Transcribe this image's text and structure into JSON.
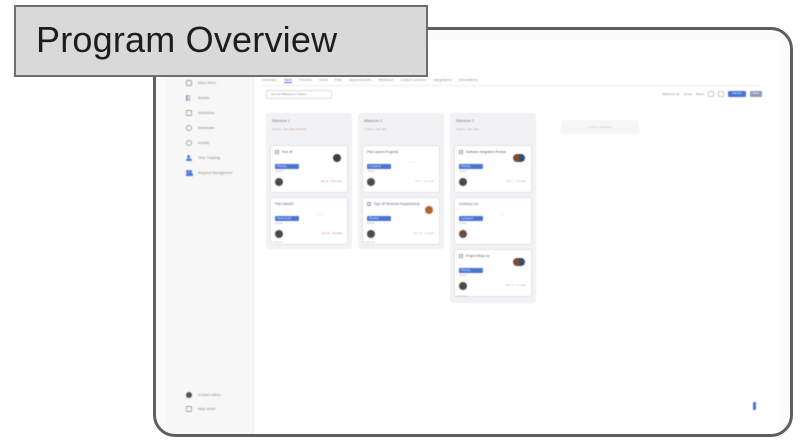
{
  "title": "Program Overview",
  "sidebar": {
    "items": [
      {
        "label": "Inbox Items"
      },
      {
        "label": "Boards"
      },
      {
        "label": "Schedules"
      },
      {
        "label": "Workloads"
      },
      {
        "label": "Activity"
      },
      {
        "label": "Time Tracking"
      },
      {
        "label": "Request Management"
      }
    ],
    "footer": [
      {
        "label": "Contact admin"
      },
      {
        "label": "Help center"
      }
    ]
  },
  "tabs": [
    "Overview",
    "Table",
    "Timeline",
    "Gantt",
    "Files",
    "Dependencies",
    "Workload",
    "Custom columns",
    "Integrations",
    "Automations"
  ],
  "active_tab": "Table",
  "toolbar": {
    "filter_label": "Sort by Milestone & Status",
    "right_text": "Milestone (3)",
    "group_label": "Group",
    "view_label": "Board",
    "primary_label": "Add item",
    "secondary_label": "Share"
  },
  "columns": [
    {
      "title": "Milestone 1",
      "subtitle": "2 items · Due date",
      "subtitle_flag": "Overdue",
      "cards": [
        {
          "title": "Kick off",
          "badge": "Planning",
          "owner": "Owner",
          "meta": "Oct 12 · Due soon",
          "meta_red": true,
          "photo": "dark"
        },
        {
          "title": "Plan Handoff",
          "badge": "Review & QA",
          "owner": "Owner",
          "meta": "Oct 24 · Overdue",
          "meta_red": true,
          "photo": "none"
        }
      ],
      "footer": "+ Add item"
    },
    {
      "title": "Milestone 2",
      "subtitle": "2 items · Due date",
      "subtitle_flag": "",
      "cards": [
        {
          "title": "Pilot Launch Progress",
          "badge": "In progress",
          "owner": "Owner",
          "meta": "Nov 3 · On track",
          "meta_red": false,
          "photo": "none"
        },
        {
          "title": "Sign-off Technical Requirements",
          "badge": "Planning",
          "owner": "Owner",
          "meta": "Nov 14 · On track",
          "meta_red": false,
          "photo": "warm"
        }
      ],
      "footer": "+ Add item"
    },
    {
      "title": "Milestone 3",
      "subtitle": "3 items · Due date",
      "subtitle_flag": "",
      "cards": [
        {
          "title": "Software Integration Review",
          "badge": "Planning",
          "owner": "Owner",
          "meta": "Dec 1 · On track",
          "meta_red": false,
          "photo": "duo"
        },
        {
          "title": "Inventory List",
          "badge": "In progress",
          "owner": "Owner",
          "meta": "Dec 8",
          "meta_red": false,
          "photo": "none"
        },
        {
          "title": "Project Wrap-Up",
          "badge": "Planning",
          "owner": "Owner",
          "meta": "Dec 19 · On track",
          "meta_red": false,
          "photo": "duo"
        }
      ],
      "footer": "+ Add item"
    }
  ],
  "add_column_label": "+ Add a milestone"
}
